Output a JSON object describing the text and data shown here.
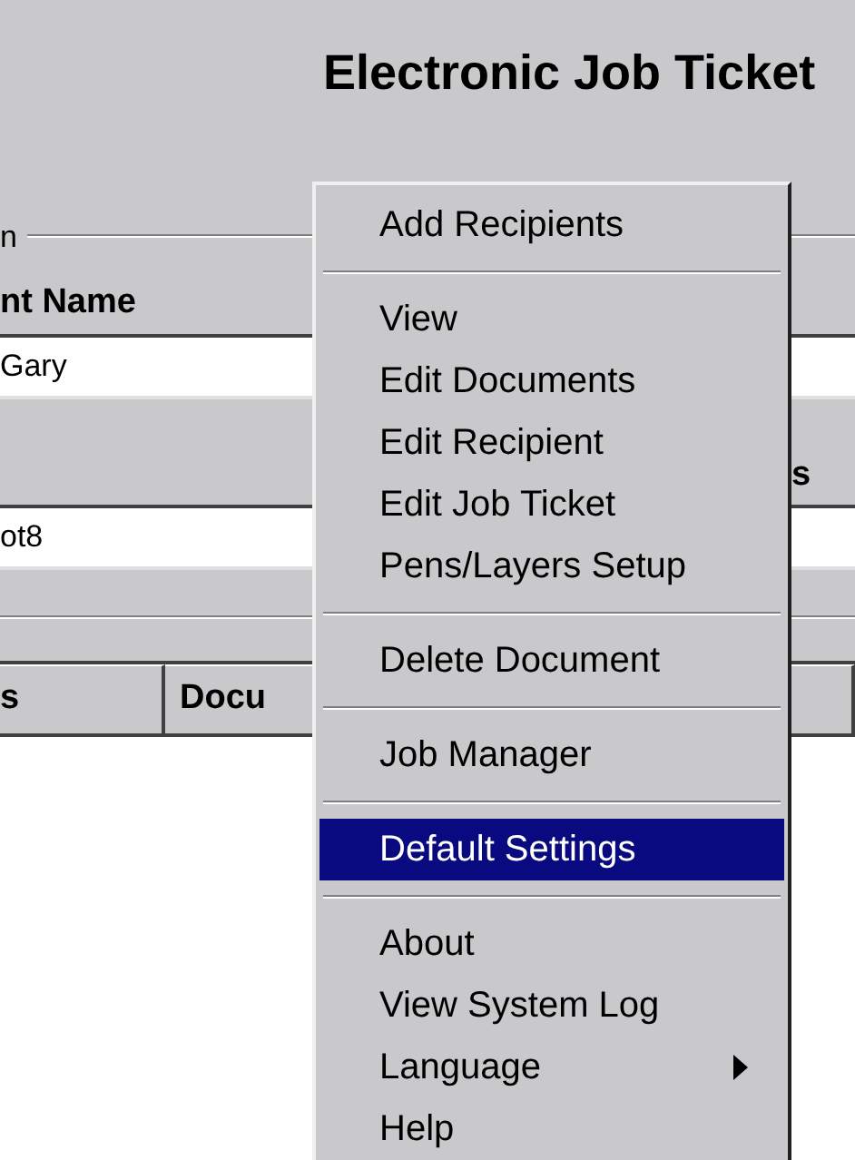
{
  "window": {
    "title": "Electronic Job Ticket"
  },
  "form": {
    "group_label": "n",
    "column_header": "nt Name",
    "recipient_field": {
      "value": "Gary"
    },
    "side_label": "s",
    "document_field": {
      "value": "ot8"
    },
    "list_headers": [
      "s",
      "Docu"
    ]
  },
  "context_menu": {
    "items": [
      {
        "kind": "item",
        "label": "Add Recipients",
        "selected": false
      },
      {
        "kind": "separator"
      },
      {
        "kind": "item",
        "label": "View",
        "selected": false
      },
      {
        "kind": "item",
        "label": "Edit Documents",
        "selected": false
      },
      {
        "kind": "item",
        "label": "Edit Recipient",
        "selected": false
      },
      {
        "kind": "item",
        "label": "Edit Job Ticket",
        "selected": false
      },
      {
        "kind": "item",
        "label": "Pens/Layers Setup",
        "selected": false
      },
      {
        "kind": "separator"
      },
      {
        "kind": "item",
        "label": "Delete Document",
        "selected": false
      },
      {
        "kind": "separator"
      },
      {
        "kind": "item",
        "label": "Job Manager",
        "selected": false
      },
      {
        "kind": "separator"
      },
      {
        "kind": "item",
        "label": "Default Settings",
        "selected": true
      },
      {
        "kind": "separator"
      },
      {
        "kind": "item",
        "label": "About",
        "selected": false
      },
      {
        "kind": "item",
        "label": "View System Log",
        "selected": false
      },
      {
        "kind": "submenu",
        "label": "Language",
        "selected": false
      },
      {
        "kind": "item",
        "label": "Help",
        "selected": false
      }
    ]
  }
}
